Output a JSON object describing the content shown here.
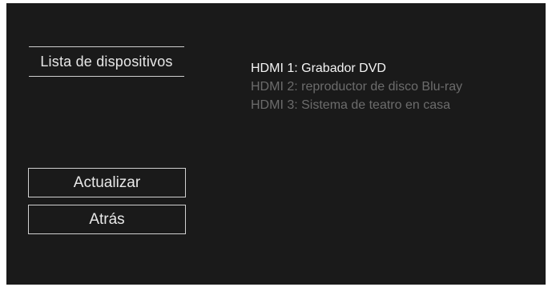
{
  "menu": {
    "title": "Lista de dispositivos"
  },
  "devices": [
    {
      "label": "HDMI 1: Grabador DVD",
      "selected": true
    },
    {
      "label": "HDMI 2: reproductor de disco Blu-ray",
      "selected": false
    },
    {
      "label": "HDMI 3: Sistema de teatro en casa",
      "selected": false
    }
  ],
  "buttons": {
    "update_label": "Actualizar",
    "back_label": "Atrás"
  },
  "colors": {
    "background": "#1a1a1a",
    "text_active": "#f4f4f4",
    "text_inactive": "#6c6c6c",
    "border": "#d0d0d0"
  }
}
